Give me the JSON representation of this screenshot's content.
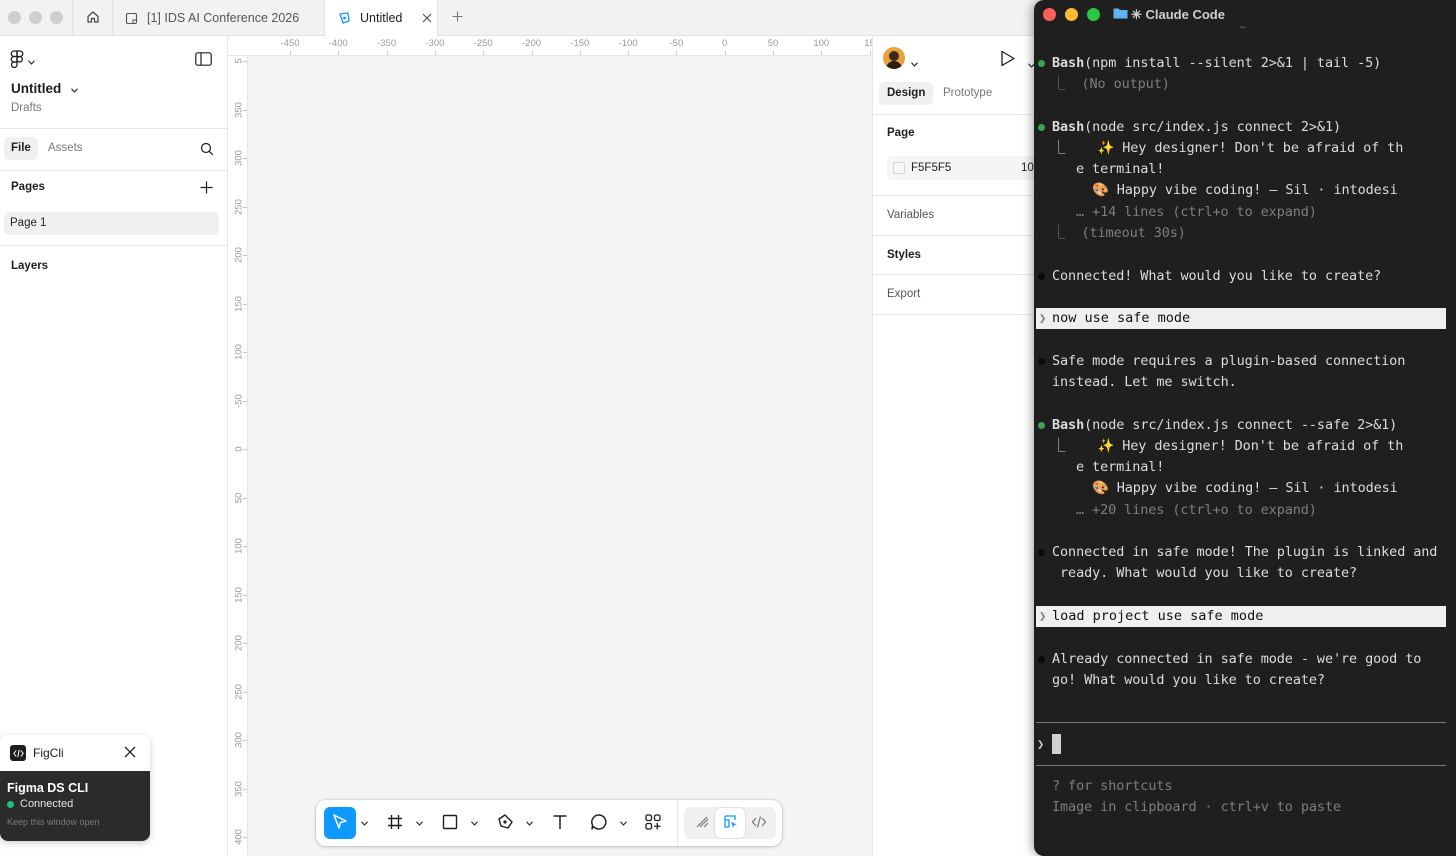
{
  "figma": {
    "tabs": [
      {
        "label": "[1] IDS AI Conference 2026"
      },
      {
        "label": "Untitled"
      }
    ],
    "file": {
      "name": "Untitled",
      "location": "Drafts"
    },
    "left_tabs": {
      "file": "File",
      "assets": "Assets"
    },
    "pages": {
      "heading": "Pages",
      "items": [
        "Page 1"
      ]
    },
    "layers": {
      "heading": "Layers"
    },
    "ruler_top": [
      "-450",
      "-400",
      "-350",
      "-300",
      "-250",
      "-200",
      "-150",
      "-100",
      "-50",
      "0",
      "50",
      "100",
      "15"
    ],
    "ruler_left": [
      "5",
      "350",
      "300",
      "250",
      "200",
      "150",
      "100",
      "-50",
      "0",
      "50",
      "100",
      "150",
      "200",
      "250",
      "300",
      "350",
      "400"
    ],
    "right_tabs": {
      "design": "Design",
      "prototype": "Prototype"
    },
    "page_section": {
      "heading": "Page",
      "color_hex": "F5F5F5",
      "opacity": "10"
    },
    "sections": {
      "variables": "Variables",
      "styles": "Styles",
      "export": "Export"
    },
    "plugin": {
      "tab_title": "FigCli",
      "title": "Figma DS CLI",
      "status": "Connected",
      "hint": "Keep this window open"
    },
    "canvas_color": "#f5f5f5",
    "accent": "#0d99ff"
  },
  "terminal": {
    "title": "✳ Claude Code",
    "top_dots": "…",
    "lines": [
      "Bash(npm install --silent 2>&1 | tail -5)",
      "⎿  (No output)",
      "Bash(node src/index.js connect 2>&1)",
      "⎿    ✨ Hey designer! Don't be afraid of th",
      "e terminal!",
      "🎨 Happy vibe coding! — Sil · intodesi",
      "… +14 lines (ctrl+o to expand)",
      "⎿  (timeout 30s)",
      "Connected! What would you like to create?",
      "now use safe mode",
      "Safe mode requires a plugin-based connection",
      "instead. Let me switch.",
      "Bash(node src/index.js connect --safe 2>&1)",
      "⎿    ✨ Hey designer! Don't be afraid of th",
      "e terminal!",
      "🎨 Happy vibe coding! — Sil · intodesi",
      "… +20 lines (ctrl+o to expand)",
      "Connected in safe mode! The plugin is linked and",
      " ready. What would you like to create?",
      "load project use safe mode",
      "Already connected in safe mode - we're good to",
      "go! What would you like to create?"
    ],
    "prompt_symbol": "❯",
    "footer": [
      "? for shortcuts",
      "Image in clipboard · ctrl+v to paste"
    ],
    "colors": {
      "bg": "#1f1f1f",
      "bullet_green": "#3fa34d"
    }
  }
}
